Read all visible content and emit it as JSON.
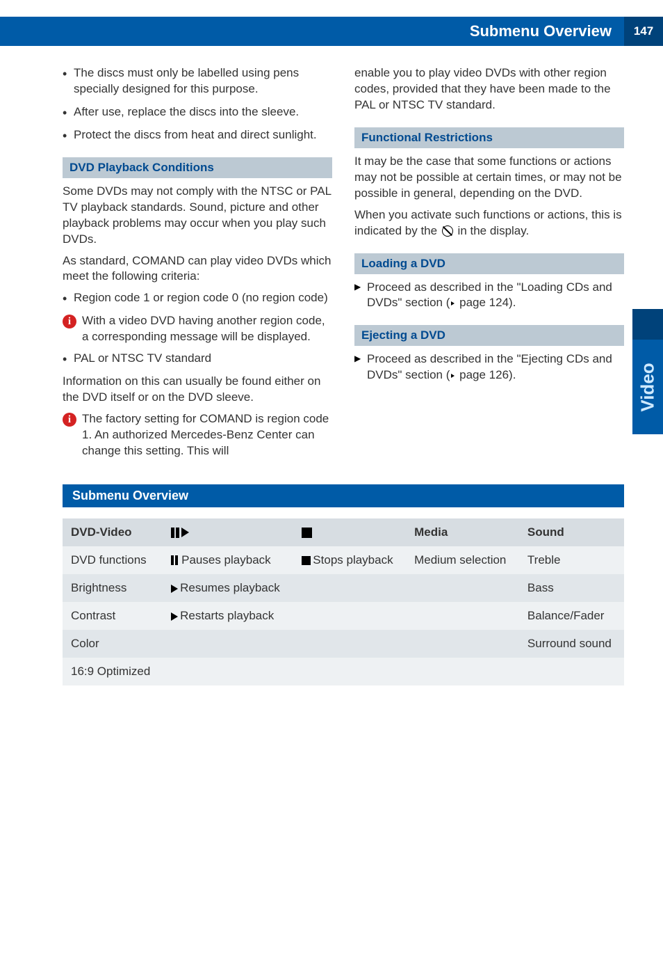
{
  "header": {
    "title": "Submenu Overview",
    "page": "147"
  },
  "sidetab": {
    "label": "Video"
  },
  "left": {
    "bullets": [
      "The discs must only be labelled using pens specially designed for this purpose.",
      "After use, replace the discs into the sleeve.",
      "Protect the discs from heat and direct sunlight."
    ],
    "h1": "DVD Playback Conditions",
    "p1": "Some DVDs may not comply with the NTSC or PAL TV playback standards. Sound, picture and other playback problems may occur when you play such DVDs.",
    "p2": "As standard, COMAND can play video DVDs which meet the following criteria:",
    "criteria": [
      "Region code 1 or region code 0 (no region code)"
    ],
    "info1": "With a video DVD having another region code, a corresponding message will be displayed.",
    "criteria2": [
      "PAL or NTSC TV standard"
    ],
    "p3": "Information on this can usually be found either on the DVD itself or on the DVD sleeve.",
    "info2": "The factory setting for COMAND is region code 1. An authorized Mercedes-Benz Center can change this setting. This will"
  },
  "right": {
    "p0": "enable you to play video DVDs with other region codes, provided that they have been made to the PAL or NTSC TV standard.",
    "h1": "Functional Restrictions",
    "p1": "It may be the case that some functions or actions may not be possible at certain times, or may not be possible in general, depending on the DVD.",
    "p2a": "When you activate such functions or actions, this is indicated by the ",
    "p2b": " in the display.",
    "h2": "Loading a DVD",
    "load": "Proceed as described in the \"Loading CDs and DVDs\" section (",
    "load_ref": " page 124).",
    "h3": "Ejecting a DVD",
    "eject": "Proceed as described in the \"Ejecting CDs and DVDs\" section (",
    "eject_ref": " page 126)."
  },
  "submenu": {
    "bar": "Submenu Overview",
    "headers": {
      "c1": "DVD-Video",
      "c4": "Media",
      "c5": "Sound"
    },
    "rows": [
      {
        "c1": "DVD functions",
        "c2": "Pauses playback",
        "c3": "Stops playback",
        "c4": "Medium selection",
        "c5": "Treble"
      },
      {
        "c1": "Brightness",
        "c2": "Resumes playback",
        "c3": "",
        "c4": "",
        "c5": "Bass"
      },
      {
        "c1": "Contrast",
        "c2": "Restarts playback",
        "c3": "",
        "c4": "",
        "c5": "Balance/Fader"
      },
      {
        "c1": "Color",
        "c2": "",
        "c3": "",
        "c4": "",
        "c5": "Surround sound"
      },
      {
        "c1": "16:9 Optimized",
        "c2": "",
        "c3": "",
        "c4": "",
        "c5": ""
      }
    ]
  }
}
